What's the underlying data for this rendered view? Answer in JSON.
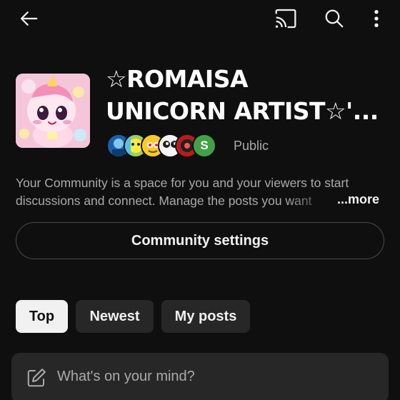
{
  "colors": {
    "background": "#0f0f0f",
    "surface": "#272727",
    "text_primary": "#f1f1f1",
    "text_secondary": "#aaaaaa",
    "chip_selected": "#f1f1f1",
    "member_s_avatar": "#43a047"
  },
  "topbar": {
    "icons": [
      "back-arrow-icon",
      "cast-icon",
      "search-icon",
      "more-vert-icon"
    ]
  },
  "community": {
    "name_line1": "☆ROMAISA",
    "name_line2": "UNICORN ARTIST☆'...",
    "visibility": "Public",
    "members": [
      {
        "icon": "member-avatar-blue"
      },
      {
        "icon": "member-avatar-colorful"
      },
      {
        "icon": "member-avatar-character"
      },
      {
        "icon": "member-avatar-eyes"
      },
      {
        "icon": "member-avatar-red"
      },
      {
        "initial": "S"
      }
    ]
  },
  "description": {
    "line1": "Your Community is a space for you and your viewers to start",
    "line2": "discussions and connect. Manage the posts you want",
    "more": "...more"
  },
  "settings_button": "Community settings",
  "filters": {
    "top": "Top",
    "newest": "Newest",
    "my_posts": "My posts",
    "selected": "Top"
  },
  "composer": {
    "placeholder": "What's on your mind?"
  }
}
